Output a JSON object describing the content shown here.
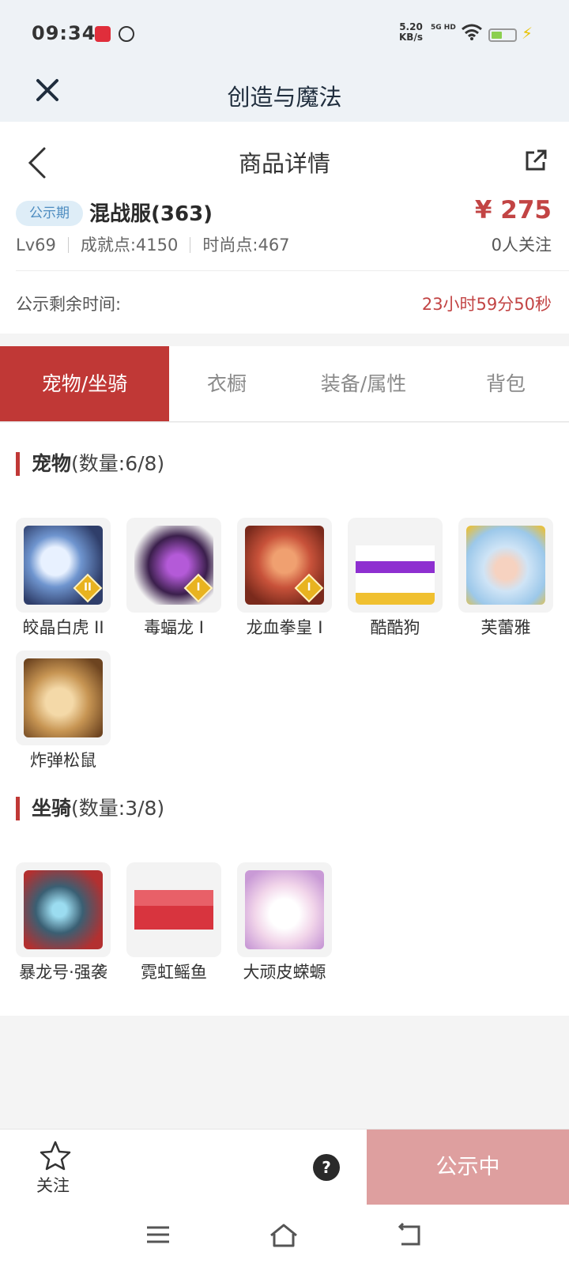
{
  "status_bar": {
    "time": "09:34",
    "speed_value": "5.20",
    "speed_unit": "KB/s",
    "network": "5G HD"
  },
  "webview": {
    "title": "创造与魔法",
    "close_icon": "close-icon"
  },
  "header": {
    "title": "商品详情",
    "back_icon": "chevron-left-icon",
    "share_icon": "share-icon"
  },
  "listing": {
    "badge": "公示期",
    "server": "混战服(363)",
    "price": "¥ 275",
    "level": "Lv69",
    "achievement": "成就点:4150",
    "fashion": "时尚点:467",
    "followers": "0人关注",
    "remain_label": "公示剩余时间:",
    "remain_value": "23小时59分50秒"
  },
  "tabs": [
    {
      "label": "宠物/坐骑",
      "active": true
    },
    {
      "label": "衣橱",
      "active": false
    },
    {
      "label": "装备/属性",
      "active": false
    },
    {
      "label": "背包",
      "active": false
    }
  ],
  "pets": {
    "title": "宠物",
    "count": "(数量:6/8)",
    "items": [
      {
        "name": "皎晶白虎 II",
        "rank": "II",
        "color": "#5f86c2"
      },
      {
        "name": "毒蝠龙 I",
        "rank": "I",
        "color": "#5a2a78"
      },
      {
        "name": "龙血拳皇 I",
        "rank": "I",
        "color": "#c8523a"
      },
      {
        "name": "酷酷狗",
        "rank": "",
        "color": "#f6f6f6"
      },
      {
        "name": "芙蕾雅",
        "rank": "",
        "color": "#9cc8ea"
      },
      {
        "name": "炸弹松鼠",
        "rank": "",
        "color": "#c79553"
      }
    ]
  },
  "mounts": {
    "title": "坐骑",
    "count": "(数量:3/8)",
    "items": [
      {
        "name": "暴龙号·强袭",
        "color": "#3a5f73"
      },
      {
        "name": "霓虹鳐鱼",
        "color": "#e0474f"
      },
      {
        "name": "大顽皮蝾螈",
        "color": "#f2d6ea"
      }
    ]
  },
  "bottom": {
    "follow_label": "关注",
    "status_button": "公示中",
    "help": "?"
  }
}
